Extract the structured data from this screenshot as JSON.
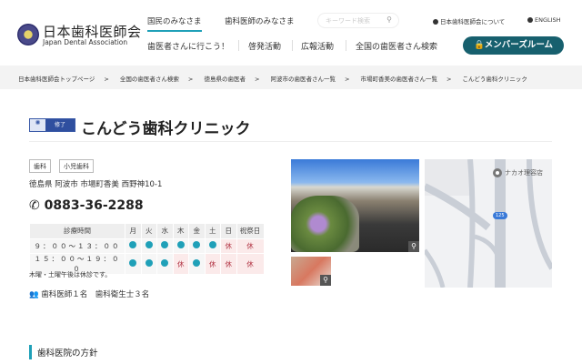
{
  "header": {
    "logo_jp": "日本歯科医師会",
    "logo_en": "Japan Dental Association",
    "tabs": [
      "国民のみなさま",
      "歯科医師のみなさま"
    ],
    "search_placeholder": "キーワード検索",
    "links": [
      "日本歯科医師会について",
      "ENGLISH"
    ],
    "nav": [
      "歯医者さんに行こう！",
      "啓発活動",
      "広報活動",
      "全国の歯医者さん検索"
    ],
    "member_button": "メンバーズルーム"
  },
  "breadcrumb": [
    "日本歯科医師会トップページ",
    "全国の歯医者さん検索",
    "徳島県の歯医者",
    "阿波市の歯医者さん一覧",
    "市場町香美の歯医者さん一覧",
    "こんどう歯科クリニック"
  ],
  "clinic": {
    "badge": "修了",
    "name": "こんどう歯科クリニック",
    "tags": [
      "歯科",
      "小児歯科"
    ],
    "address": "徳島県 阿波市 市場町香美 西野神10-1",
    "phone": "0883-36-2288",
    "note": "木曜・土曜午後は休診です。",
    "staff": "歯科医師１名　歯科衛生士３名"
  },
  "schedule": {
    "header": [
      "診療時間",
      "月",
      "火",
      "水",
      "木",
      "金",
      "土",
      "日",
      "祝祭日"
    ],
    "rows": [
      {
        "time": "９：００〜１３：００",
        "days": [
          "o",
          "o",
          "o",
          "o",
          "o",
          "o",
          "休",
          "休"
        ]
      },
      {
        "time": "１５：００〜１９：００",
        "days": [
          "o",
          "o",
          "o",
          "休",
          "o",
          "休",
          "休",
          "休"
        ]
      }
    ]
  },
  "map": {
    "label": "ナカオ理容店",
    "route": "125"
  },
  "section": {
    "policy": "歯科医院の方針"
  },
  "colors": {
    "accent": "#1fa0b8",
    "member": "#17606e",
    "closed": "#b03040"
  }
}
